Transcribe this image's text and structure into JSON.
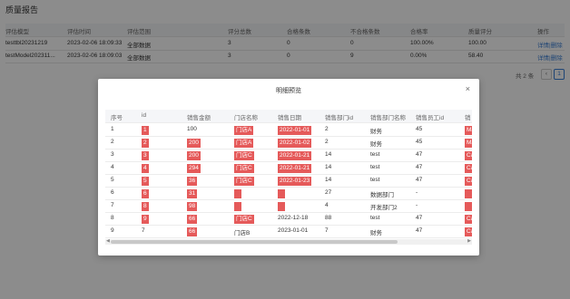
{
  "page": {
    "title": "质量报告"
  },
  "background_table": {
    "headers": [
      "评估模型",
      "评估时间",
      "评估范围",
      "评分总数",
      "合格条数",
      "不合格条数",
      "合格率",
      "质量评分",
      "操作"
    ],
    "rows": [
      [
        "testtbl20231219",
        "2023-02-06 18:09:33",
        "全部数据",
        "3",
        "0",
        "0",
        "100.00%",
        "100.00",
        "详情|删除"
      ],
      [
        "testModel202311...",
        "2023-02-06 18:09:03",
        "全部数据",
        "3",
        "0",
        "9",
        "0.00%",
        "58.40",
        "详情|删除"
      ]
    ]
  },
  "pagination": {
    "total": "共 2 条",
    "prev": "‹",
    "page": "1"
  },
  "modal": {
    "title": "明细预览",
    "close": "×",
    "columns": [
      "序号",
      "id",
      "销售金额",
      "门店名称",
      "销售日期",
      "销售部门id",
      "销售部门名称",
      "销售员工id",
      "销"
    ],
    "rows": [
      {
        "cells": [
          "1",
          "1",
          "100",
          "门店A",
          "2022-01-01",
          "2",
          "财务",
          "45",
          "Ma"
        ],
        "red": [
          1,
          3,
          4,
          8
        ]
      },
      {
        "cells": [
          "2",
          "2",
          "200",
          "门店A",
          "2022-01-02",
          "2",
          "财务",
          "45",
          "Ma"
        ],
        "red": [
          1,
          2,
          3,
          4,
          8
        ]
      },
      {
        "cells": [
          "3",
          "3",
          "200",
          "门店C",
          "2022-01-21",
          "14",
          "test",
          "47",
          "Ca"
        ],
        "red": [
          1,
          2,
          3,
          4,
          8
        ]
      },
      {
        "cells": [
          "4",
          "4",
          "294",
          "门店C",
          "2022-01-21",
          "14",
          "test",
          "47",
          "Ca"
        ],
        "red": [
          1,
          2,
          3,
          4,
          8
        ]
      },
      {
        "cells": [
          "5",
          "5",
          "36",
          "门店C",
          "2022-01-23",
          "14",
          "test",
          "47",
          "Ca"
        ],
        "red": [
          1,
          2,
          3,
          4,
          8
        ]
      },
      {
        "cells": [
          "6",
          "6",
          "31",
          "",
          "",
          "27",
          "数据部门",
          "-",
          ""
        ],
        "red": [
          1,
          2,
          3,
          4,
          8
        ]
      },
      {
        "cells": [
          "7",
          "8",
          "98",
          "",
          "",
          "4",
          "开发部门2",
          "-",
          ""
        ],
        "red": [
          1,
          2,
          3,
          4,
          8
        ]
      },
      {
        "cells": [
          "8",
          "9",
          "66",
          "门店C",
          "2022-12-18",
          "88",
          "test",
          "47",
          "Ca"
        ],
        "red": [
          1,
          2,
          3,
          8
        ]
      },
      {
        "cells": [
          "9",
          "7",
          "66",
          "门店B",
          "2023-01-01",
          "7",
          "财务",
          "47",
          "Ca"
        ],
        "red": [
          2,
          8
        ]
      }
    ]
  },
  "colors": {
    "accent": "#3a7fd5",
    "error": "#e55a5a",
    "overlay": "rgba(0,0,0,0.45)"
  }
}
